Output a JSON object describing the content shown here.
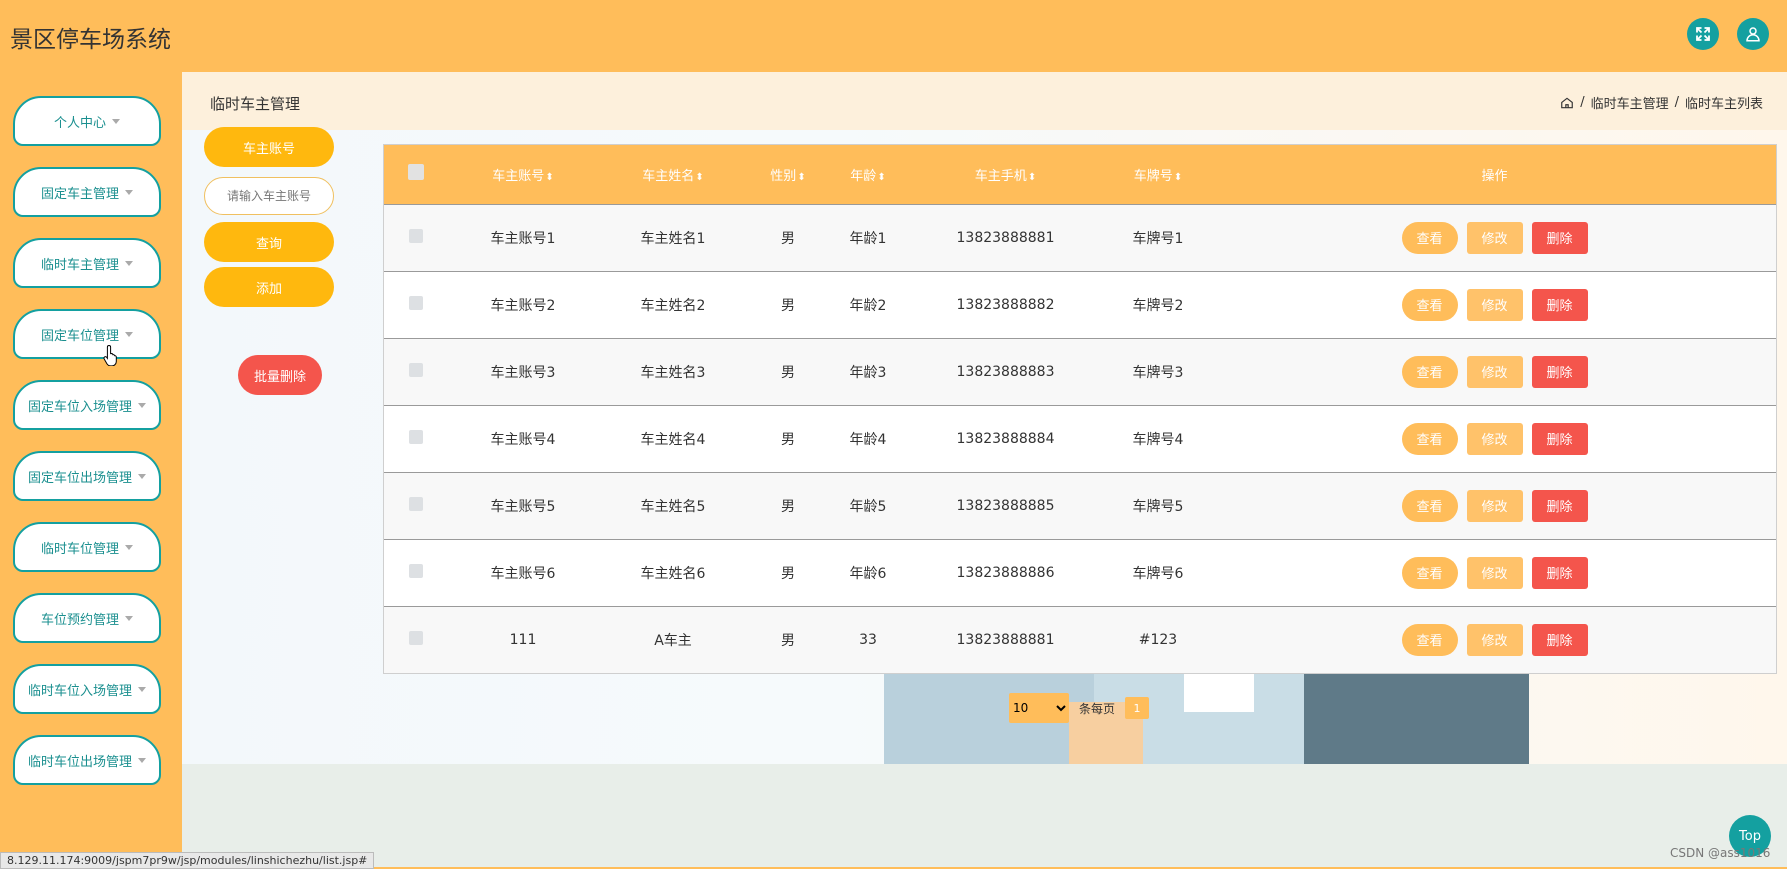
{
  "header": {
    "app_title": "景区停车场系统"
  },
  "sidebar": {
    "items": [
      {
        "label": "个人中心"
      },
      {
        "label": "固定车主管理"
      },
      {
        "label": "临时车主管理"
      },
      {
        "label": "固定车位管理"
      },
      {
        "label": "固定车位入场管理"
      },
      {
        "label": "固定车位出场管理"
      },
      {
        "label": "临时车位管理"
      },
      {
        "label": "车位预约管理"
      },
      {
        "label": "临时车位入场管理"
      },
      {
        "label": "临时车位出场管理"
      }
    ]
  },
  "page": {
    "title": "临时车主管理",
    "breadcrumb": [
      "临时车主管理",
      "临时车主列表"
    ]
  },
  "search": {
    "label": "车主账号",
    "placeholder": "请输入车主账号",
    "query_button": "查询",
    "add_button": "添加",
    "batch_delete_button": "批量删除"
  },
  "table": {
    "columns": [
      "车主账号",
      "车主姓名",
      "性别",
      "年龄",
      "车主手机",
      "车牌号",
      "操作"
    ],
    "sort_glyph": "⬍",
    "actions": {
      "view": "查看",
      "edit": "修改",
      "delete": "删除"
    },
    "rows": [
      {
        "account": "车主账号1",
        "name": "车主姓名1",
        "gender": "男",
        "age": "年龄1",
        "phone": "13823888881",
        "plate": "车牌号1"
      },
      {
        "account": "车主账号2",
        "name": "车主姓名2",
        "gender": "男",
        "age": "年龄2",
        "phone": "13823888882",
        "plate": "车牌号2"
      },
      {
        "account": "车主账号3",
        "name": "车主姓名3",
        "gender": "男",
        "age": "年龄3",
        "phone": "13823888883",
        "plate": "车牌号3"
      },
      {
        "account": "车主账号4",
        "name": "车主姓名4",
        "gender": "男",
        "age": "年龄4",
        "phone": "13823888884",
        "plate": "车牌号4"
      },
      {
        "account": "车主账号5",
        "name": "车主姓名5",
        "gender": "男",
        "age": "年龄5",
        "phone": "13823888885",
        "plate": "车牌号5"
      },
      {
        "account": "车主账号6",
        "name": "车主姓名6",
        "gender": "男",
        "age": "年龄6",
        "phone": "13823888886",
        "plate": "车牌号6"
      },
      {
        "account": "111",
        "name": "A车主",
        "gender": "男",
        "age": "33",
        "phone": "13823888881",
        "plate": "#123"
      }
    ]
  },
  "pagination": {
    "page_size": "10",
    "page_size_options": [
      "10"
    ],
    "per_page_label": "条每页",
    "current_page": "1"
  },
  "misc": {
    "top_button": "Top",
    "status_url": "8.129.11.174:9009/jspm7pr9w/jsp/modules/linshichezhu/list.jsp#",
    "watermark": "CSDN @ass1016"
  },
  "colors": {
    "accent": "#ffbd5a",
    "button_yellow": "#ffb80e",
    "teal": "#14a0a0",
    "danger": "#f4554c"
  },
  "icons": {
    "fullscreen": "expand-icon",
    "user": "user-icon",
    "home": "home-icon",
    "cursor": "hand-cursor-icon"
  }
}
